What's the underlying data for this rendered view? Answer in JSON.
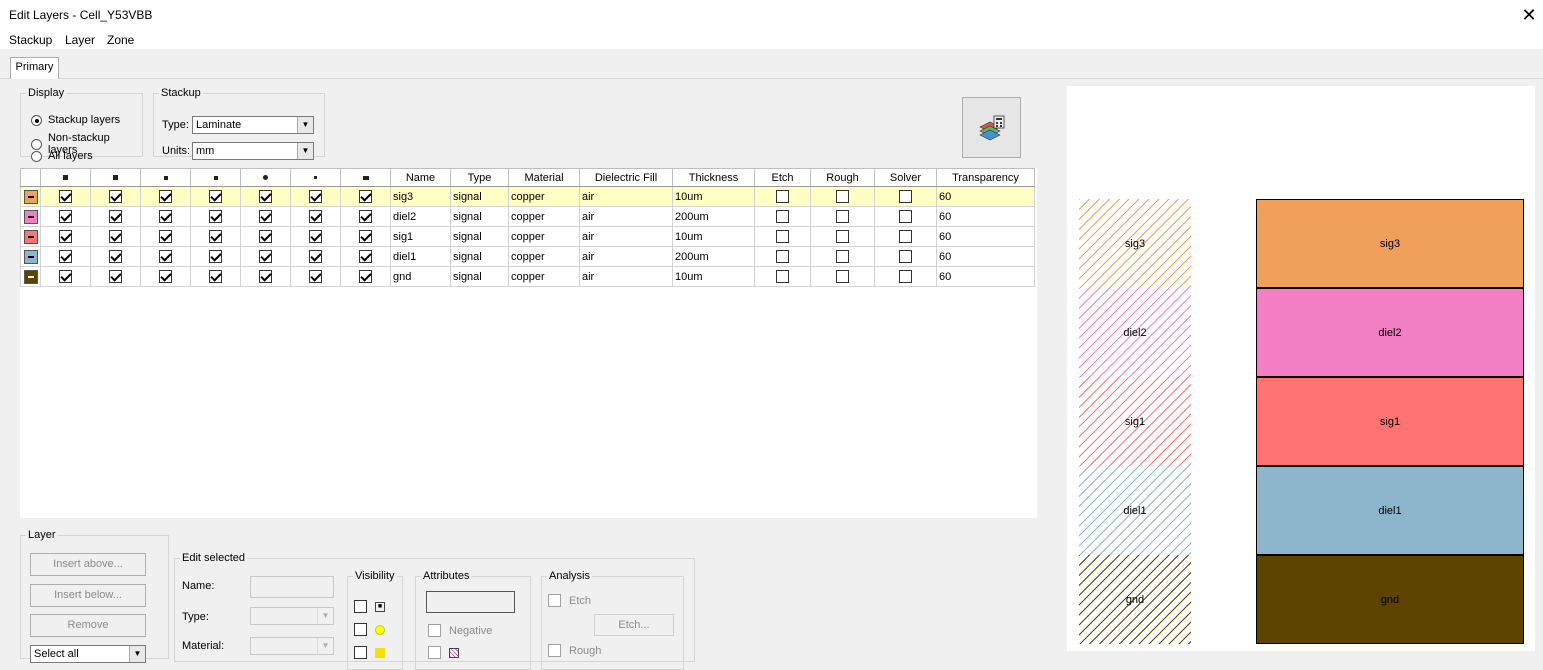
{
  "window": {
    "title": "Edit Layers - Cell_Y53VBB",
    "close_glyph": "✕"
  },
  "menu": [
    "Stackup",
    "Layer",
    "Zone"
  ],
  "tabs": [
    "Primary"
  ],
  "display": {
    "legend": "Display",
    "options": [
      {
        "label": "Stackup layers",
        "selected": true
      },
      {
        "label": "Non-stackup layers",
        "selected": false
      },
      {
        "label": "All layers",
        "selected": false
      }
    ]
  },
  "stackup": {
    "legend": "Stackup",
    "type_label": "Type:",
    "type_value": "Laminate",
    "units_label": "Units:",
    "units_value": "mm"
  },
  "grid": {
    "columns": [
      "Name",
      "Type",
      "Material",
      "Dielectric Fill",
      "Thickness",
      "Etch",
      "Rough",
      "Solver",
      "Transparency"
    ],
    "rows": [
      {
        "color": "#f0a05a",
        "name": "sig3",
        "type": "signal",
        "material": "copper",
        "fill": "air",
        "thickness": "10um",
        "etch": false,
        "rough": false,
        "solver": false,
        "transparency": "60",
        "selected": true
      },
      {
        "color": "#f27fc3",
        "name": "diel2",
        "type": "signal",
        "material": "copper",
        "fill": "air",
        "thickness": "200um",
        "etch": false,
        "rough": false,
        "solver": false,
        "transparency": "60",
        "selected": false
      },
      {
        "color": "#ff7373",
        "name": "sig1",
        "type": "signal",
        "material": "copper",
        "fill": "air",
        "thickness": "10um",
        "etch": false,
        "rough": false,
        "solver": false,
        "transparency": "60",
        "selected": false
      },
      {
        "color": "#8db5cc",
        "name": "diel1",
        "type": "signal",
        "material": "copper",
        "fill": "air",
        "thickness": "200um",
        "etch": false,
        "rough": false,
        "solver": false,
        "transparency": "60",
        "selected": false
      },
      {
        "color": "#5c4300",
        "name": "gnd",
        "type": "signal",
        "material": "copper",
        "fill": "air",
        "thickness": "10um",
        "etch": false,
        "rough": false,
        "solver": false,
        "transparency": "60",
        "selected": false
      }
    ]
  },
  "layer_group": {
    "legend": "Layer",
    "insert_above": "Insert above...",
    "insert_below": "Insert below...",
    "remove": "Remove",
    "select_value": "Select all"
  },
  "edit_selected": {
    "legend": "Edit selected",
    "name_label": "Name:",
    "type_label": "Type:",
    "material_label": "Material:"
  },
  "visibility": {
    "legend": "Visibility"
  },
  "attributes": {
    "legend": "Attributes",
    "negative_label": "Negative"
  },
  "analysis": {
    "legend": "Analysis",
    "etch_label": "Etch",
    "etch_button": "Etch...",
    "rough_label": "Rough"
  },
  "preview": {
    "layers": [
      "sig3",
      "diel2",
      "sig1",
      "diel1",
      "gnd"
    ]
  }
}
